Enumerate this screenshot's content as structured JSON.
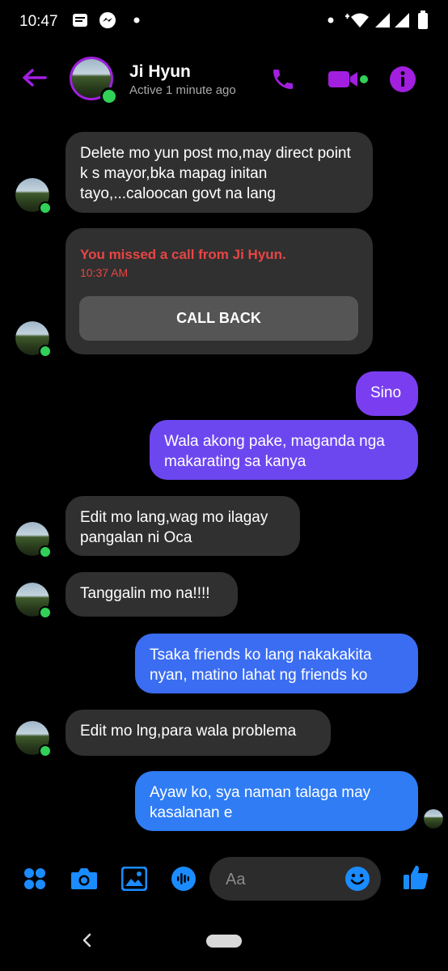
{
  "status_bar": {
    "time": "10:47",
    "left_icons": [
      "notification-icon",
      "messenger-icon",
      "dot-icon"
    ],
    "right_icons": [
      "dot-icon",
      "wifi-icon",
      "signal-icon",
      "signal-icon",
      "battery-icon"
    ]
  },
  "header": {
    "contact_name": "Ji Hyun",
    "contact_status": "Active 1 minute ago",
    "accent_color": "#a21fe0"
  },
  "messages": [
    {
      "from": "them",
      "text": "Delete mo yun post mo,may direct point k s mayor,bka mapag initan tayo,...caloocan govt na lang"
    },
    {
      "from": "them",
      "type": "missed_call",
      "title": "You missed a call from Ji Hyun.",
      "time": "10:37 AM",
      "button": "CALL BACK"
    },
    {
      "from": "me",
      "text": "Sino"
    },
    {
      "from": "me",
      "text": "Wala akong pake, maganda nga makarating sa kanya"
    },
    {
      "from": "them",
      "text": "Edit mo lang,wag mo ilagay pangalan ni Oca"
    },
    {
      "from": "them",
      "text": "Tanggalin mo na!!!!"
    },
    {
      "from": "me",
      "text": "Tsaka friends ko lang nakakakita nyan, matino lahat ng friends ko"
    },
    {
      "from": "them",
      "text": "Edit mo lng,para wala problema"
    },
    {
      "from": "me",
      "text": "Ayaw ko, sya naman talaga may kasalanan e"
    }
  ],
  "composer": {
    "placeholder": "Aa",
    "value": ""
  }
}
